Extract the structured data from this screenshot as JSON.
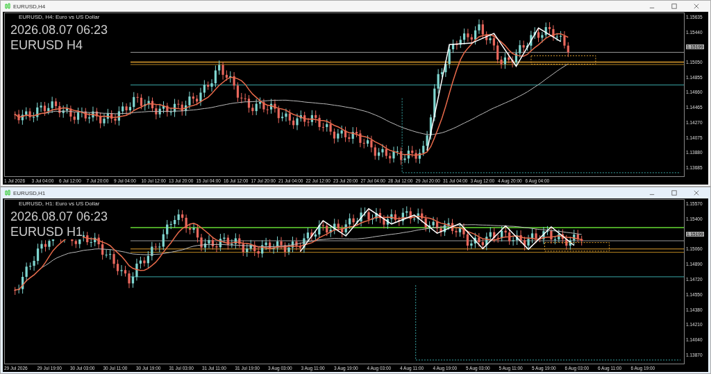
{
  "charts": [
    {
      "window_title": "EURUSD,H4",
      "chart_header": "EURUSD, H4:  Euro vs US Dollar",
      "overlay_lines": [
        "2026.08.07 06:23",
        "EURUSD H4"
      ],
      "price_axis": [
        {
          "kind": "tick",
          "text": "1.15635"
        },
        {
          "kind": "tick",
          "text": "1.15440"
        },
        {
          "kind": "badge",
          "text": "1.15199"
        },
        {
          "kind": "tick",
          "text": "1.15050"
        },
        {
          "kind": "tick",
          "text": "1.14855"
        },
        {
          "kind": "tick",
          "text": "1.14660"
        },
        {
          "kind": "tick",
          "text": "1.14465"
        },
        {
          "kind": "tick",
          "text": "1.14270"
        },
        {
          "kind": "tick",
          "text": "1.14075"
        },
        {
          "kind": "tick",
          "text": "1.13880"
        },
        {
          "kind": "tick",
          "text": "1.13685"
        }
      ],
      "time_axis": [
        "1 Jul 2026",
        "3 Jul 04:00",
        "6 Jul 12:00",
        "7 Jul 20:00",
        "9 Jul 04:00",
        "10 Jul 12:00",
        "13 Jul 20:00",
        "15 Jul 04:00",
        "16 Jul 12:00",
        "17 Jul 20:00",
        "21 Jul 04:00",
        "22 Jul 12:00",
        "23 Jul 20:00",
        "27 Jul 04:00",
        "28 Jul 12:00",
        "29 Jul 20:00",
        "31 Jul 04:00",
        "3 Aug 12:00",
        "4 Aug 20:00",
        "6 Aug 04:00"
      ]
    },
    {
      "window_title": "EURUSD,H1",
      "chart_header": "EURUSD, H1:  Euro vs US Dollar",
      "overlay_lines": [
        "2026.08.07 06:23",
        "EURUSD H1"
      ],
      "price_axis": [
        {
          "kind": "tick",
          "text": "1.15570"
        },
        {
          "kind": "tick",
          "text": "1.15400"
        },
        {
          "kind": "badge",
          "text": "1.15199"
        },
        {
          "kind": "tick",
          "text": "1.15060"
        },
        {
          "kind": "tick",
          "text": "1.14890"
        },
        {
          "kind": "tick",
          "text": "1.14720"
        },
        {
          "kind": "tick",
          "text": "1.14550"
        },
        {
          "kind": "tick",
          "text": "1.14380"
        },
        {
          "kind": "tick",
          "text": "1.14210"
        },
        {
          "kind": "tick",
          "text": "1.14040"
        },
        {
          "kind": "tick",
          "text": "1.13870"
        }
      ],
      "time_axis": [
        "29 Jul 2026",
        "29 Jul 19:00",
        "30 Jul 03:00",
        "30 Jul 11:00",
        "30 Jul 19:00",
        "31 Jul 03:00",
        "31 Jul 11:00",
        "31 Jul 19:00",
        "3 Aug 03:00",
        "3 Aug 11:00",
        "3 Aug 19:00",
        "4 Aug 03:00",
        "4 Aug 11:00",
        "4 Aug 19:00",
        "5 Aug 03:00",
        "5 Aug 11:00",
        "5 Aug 19:00",
        "6 Aug 03:00",
        "6 Aug 11:00",
        "6 Aug 19:00"
      ]
    }
  ]
}
